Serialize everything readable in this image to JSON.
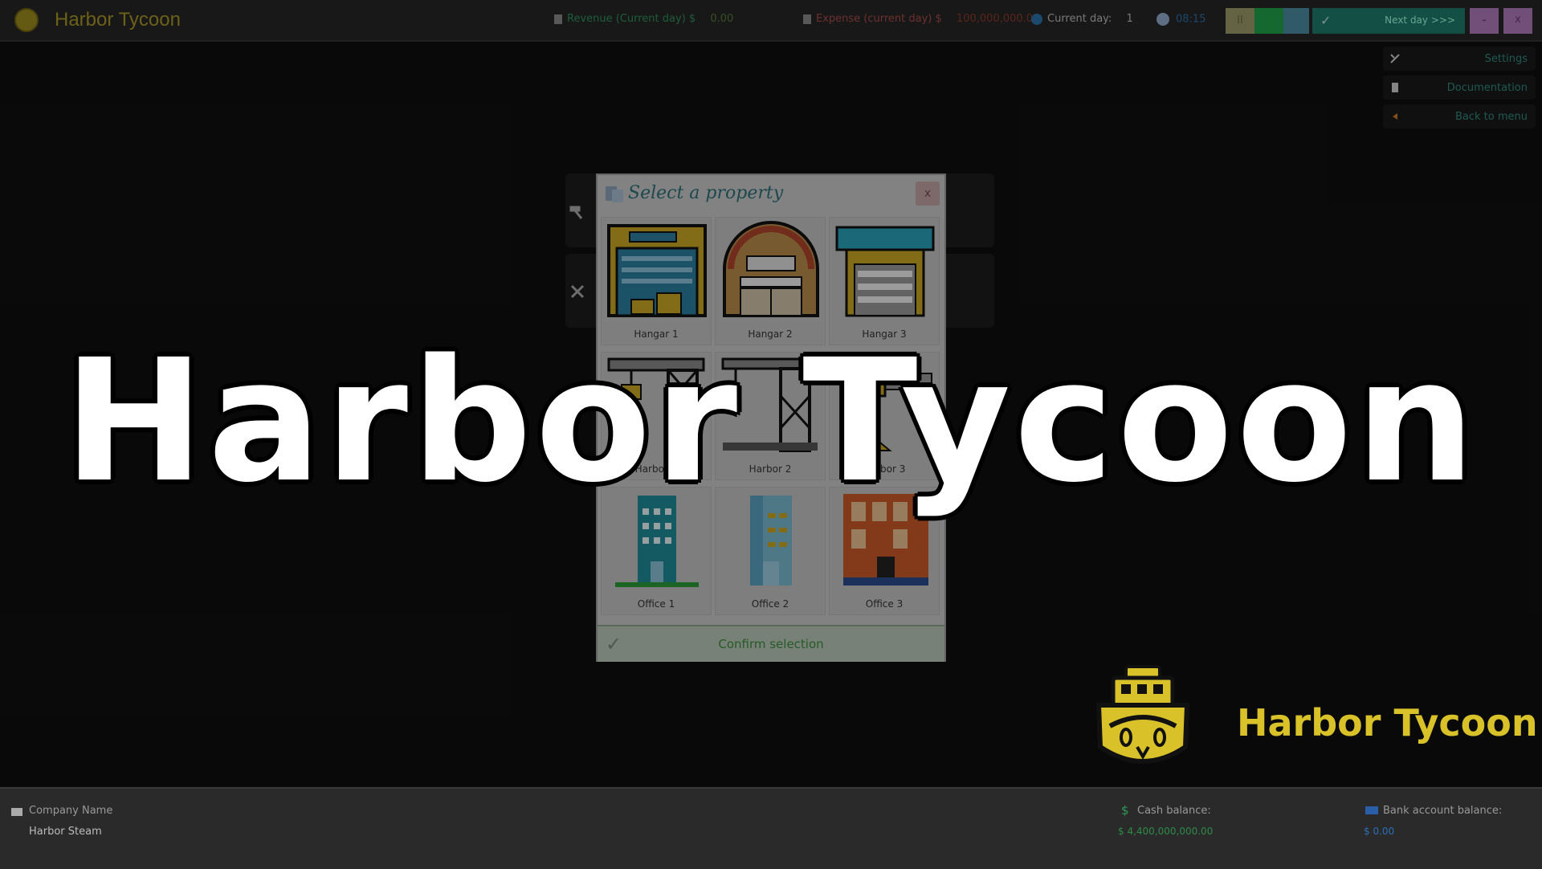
{
  "app": {
    "title": "Harbor Tycoon"
  },
  "topbar": {
    "revenue_label": "Revenue (Current day) $",
    "revenue_value": "0.00",
    "expense_label": "Expense (current day) $",
    "expense_value": "100,000,000.00",
    "current_day_label": "Current day:",
    "current_day_value": "1",
    "clock": "08:15",
    "next_day_label": "Next day >>>",
    "pause_label": "II",
    "minimize_label": "-",
    "close_label": "x"
  },
  "menu": {
    "settings": "Settings",
    "documentation": "Documentation",
    "back": "Back to menu"
  },
  "modal": {
    "title": "Select a property",
    "close": "x",
    "confirm": "Confirm selection",
    "items": [
      {
        "label": "Hangar 1",
        "icon": "hangar-1-icon"
      },
      {
        "label": "Hangar 2",
        "icon": "hangar-2-icon"
      },
      {
        "label": "Hangar 3",
        "icon": "hangar-3-icon"
      },
      {
        "label": "Harbor 1",
        "icon": "harbor-1-icon"
      },
      {
        "label": "Harbor 2",
        "icon": "harbor-2-icon"
      },
      {
        "label": "Harbor 3",
        "icon": "harbor-3-icon"
      },
      {
        "label": "Office 1",
        "icon": "office-1-icon"
      },
      {
        "label": "Office 2",
        "icon": "office-2-icon"
      },
      {
        "label": "Office 3",
        "icon": "office-3-icon"
      }
    ]
  },
  "bottombar": {
    "company_label": "Company Name",
    "company_value": "Harbor Steam",
    "cash_label": "Cash balance:",
    "cash_value": "$ 4,400,000,000.00",
    "bank_label": "Bank account balance:",
    "bank_value": "$ 0.00"
  },
  "overlay": {
    "big_title": "Harbor Tycoon",
    "brand_name": "Harbor Tycoon"
  },
  "colors": {
    "accent_gold": "#d9c12a",
    "teal": "#1f8a78",
    "pink": "#c27ac9"
  }
}
